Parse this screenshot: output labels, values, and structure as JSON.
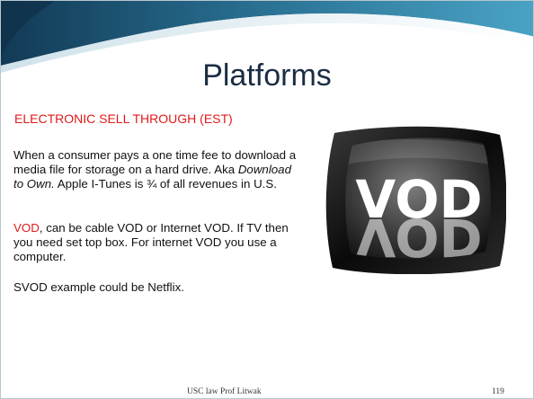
{
  "slide": {
    "title": "Platforms",
    "subheading": "ELECTRONIC SELL THROUGH (EST)",
    "para1": {
      "text1": " When a consumer pays a one time fee to download a media file for storage on a hard drive. Aka ",
      "italic": "Download to Own.",
      "text2": " Apple I-Tunes is ¾ of all revenues in U.S."
    },
    "para2": {
      "red": "VOD",
      "text": ", can be cable VOD or Internet VOD. If TV then you need  set top box. For internet VOD you use a computer."
    },
    "para3": "SVOD example could be Netflix.",
    "image": {
      "text": "VOD",
      "reflection": "VOD",
      "icon": "vod-tv-image"
    },
    "footer": "USC law Prof Litwak",
    "page_number": "119"
  },
  "colors": {
    "title": "#1b2d44",
    "accent": "#e01a1a",
    "banner": "#1f4f6f"
  }
}
